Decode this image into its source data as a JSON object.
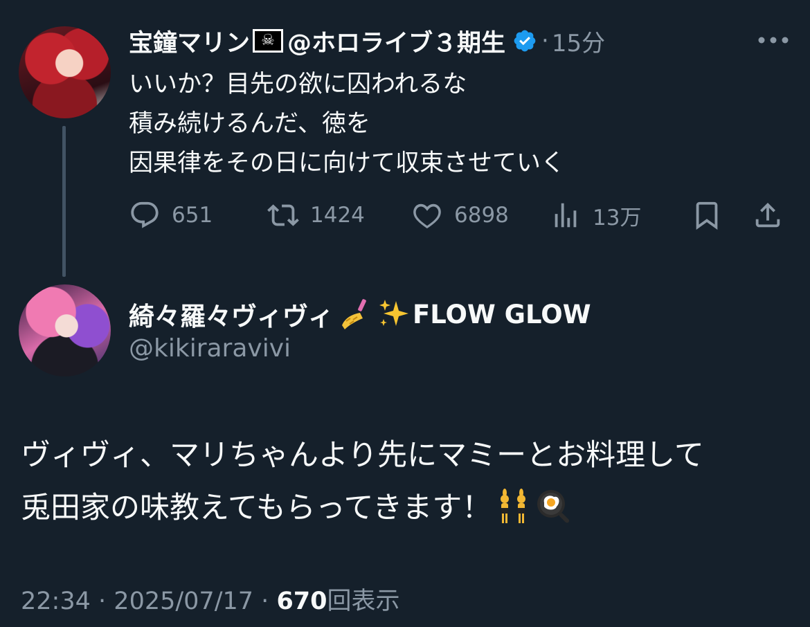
{
  "colors": {
    "background": "#15202b",
    "text_primary": "#f7f9f9",
    "text_secondary": "#8b98a5",
    "verified_badge": "#1d9bf0",
    "thread_line": "#425364"
  },
  "parent_tweet": {
    "display_name": "宝鐘マリン",
    "name_emoji": "pirate-flag-icon",
    "handle_suffix": "@ホロライブ３期生",
    "separator": "·",
    "time_ago": "15分",
    "body_lines": [
      "いいか？目先の欲に囚われるな",
      "積み続けるんだ、徳を",
      "因果律をその日に向けて収束させていく"
    ],
    "actions": {
      "replies": "651",
      "retweets": "1424",
      "likes": "6898",
      "views": "13万"
    }
  },
  "reply_tweet": {
    "display_name": "綺々羅々ヴィヴィ",
    "name_suffix": "FLOW GLOW",
    "handle": "@kikiraravivi",
    "body_lines": [
      "ヴィヴィ、マリちゃんより先にマミーとお料理して",
      "兎田家の味教えてもらってきます！"
    ]
  },
  "footer": {
    "time": "22:34",
    "separator": "·",
    "date": "2025/07/17",
    "views_count": "670",
    "views_label": "回表示"
  }
}
